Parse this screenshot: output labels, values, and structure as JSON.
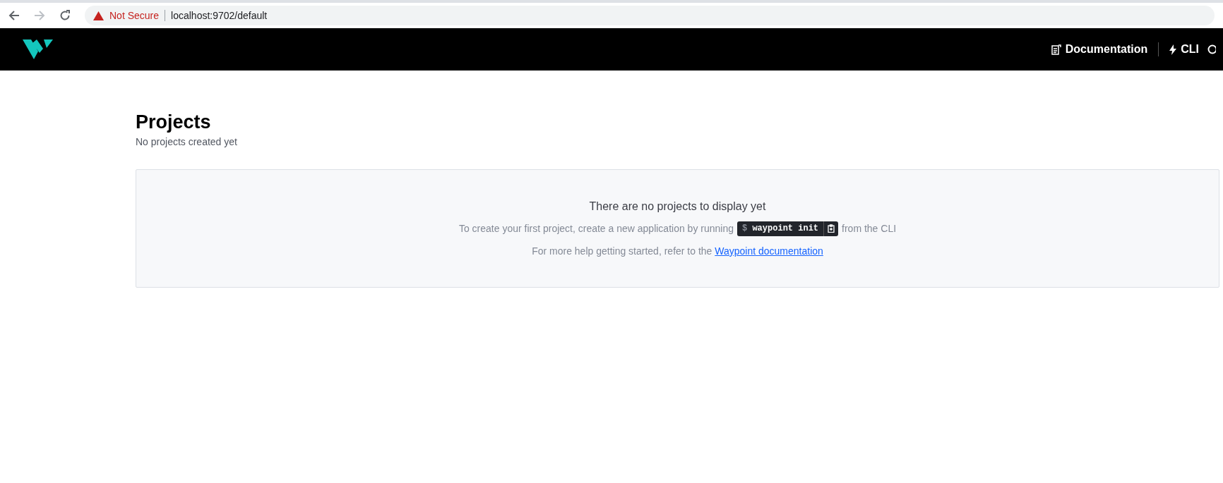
{
  "browser": {
    "security": "Not Secure",
    "url": "localhost:9702/default"
  },
  "nav": {
    "links": [
      {
        "kind": "docs",
        "label": "Documentation"
      },
      {
        "kind": "cli",
        "label": "CLI"
      }
    ]
  },
  "page": {
    "title": "Projects",
    "subtitle": "No projects created yet"
  },
  "empty_state": {
    "heading": "There are no projects to display yet",
    "instruction_before": "To create your first project, create a new application by running",
    "command_prompt": "$",
    "command": "waypoint init",
    "instruction_after": "from the CLI",
    "help_text": "For more help getting started, refer to the",
    "help_link": "Waypoint documentation"
  }
}
